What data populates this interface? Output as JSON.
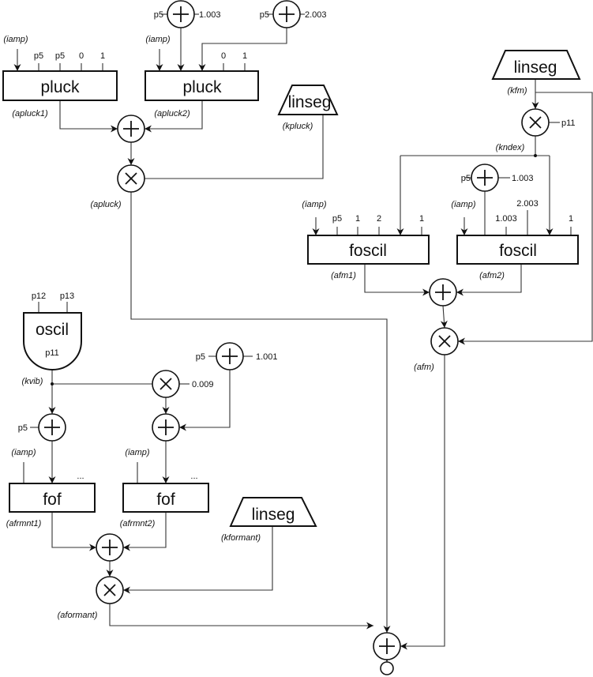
{
  "operators": {
    "pluck1": "pluck",
    "pluck2": "pluck",
    "linseg_kpluck": "linseg",
    "linseg_kfm": "linseg",
    "foscil1": "foscil",
    "foscil2": "foscil",
    "oscil": "oscil",
    "oscil_table": "p11",
    "fof1": "fof",
    "fof2": "fof",
    "linseg_kformant": "linseg"
  },
  "signals": {
    "iamp": "(iamp)",
    "apluck1": "(apluck1)",
    "apluck2": "(apluck2)",
    "kpluck": "(kpluck)",
    "apluck": "(apluck)",
    "kfm": "(kfm)",
    "kndex": "(kndex)",
    "afm1": "(afm1)",
    "afm2": "(afm2)",
    "afm": "(afm)",
    "kvib": "(kvib)",
    "afrmnt1": "(afrmnt1)",
    "afrmnt2": "(afrmnt2)",
    "kformant": "(kformant)",
    "aformant": "(aformant)"
  },
  "args": {
    "p5": "p5",
    "zero": "0",
    "one": "1",
    "two": "2",
    "c1003": "1.003",
    "c2003": "2.003",
    "c1001": "1.001",
    "c0009": "0.009",
    "p11": "p11",
    "p12": "p12",
    "p13": "p13",
    "ellipsis": "..."
  },
  "icons": {
    "adder": "plus-circle",
    "multiplier": "times-circle",
    "output": "open-circle"
  }
}
